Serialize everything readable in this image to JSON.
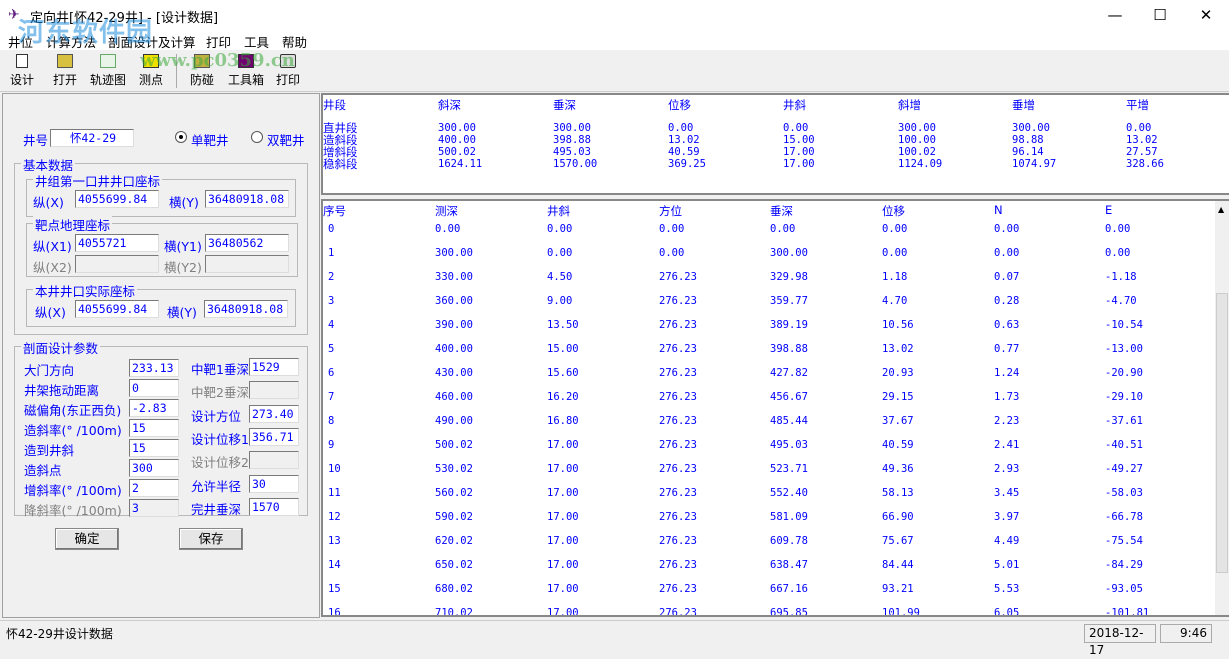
{
  "window": {
    "title": "定向井[怀42-29井] - [设计数据]",
    "minimize": "—",
    "maximize": "☐",
    "close": "✕"
  },
  "watermark": {
    "text": "河东软件园",
    "url": "www.pc0359.cn"
  },
  "menu": [
    "井位",
    "计算方法",
    "剖面设计及计算",
    "打印",
    "工具",
    "帮助"
  ],
  "toolbar": [
    {
      "label": "设计",
      "icon": "new-document-icon"
    },
    {
      "label": "打开",
      "icon": "open-folder-icon"
    },
    {
      "label": "轨迹图",
      "icon": "trajectory-chart-icon"
    },
    {
      "label": "测点",
      "icon": "survey-point-icon"
    },
    {
      "label": "防碰",
      "icon": "anti-collision-icon"
    },
    {
      "label": "工具箱",
      "icon": "toolbox-icon"
    },
    {
      "label": "打印",
      "icon": "printer-icon"
    }
  ],
  "form": {
    "well_no_label": "井号",
    "well_no": "怀42-29",
    "single_target": "单靶井",
    "double_target": "双靶井",
    "single_selected": true,
    "basic_group": "基本数据",
    "group_first": "井组第一口井井口座标",
    "x_label": "纵(X)",
    "y_label": "横(Y)",
    "first_x": "4055699.84",
    "first_y": "36480918.08",
    "group_target": "靶点地理座标",
    "x1_label": "纵(X1)",
    "y1_label": "横(Y1)",
    "x1": "4055721",
    "y1": "36480562",
    "x2_label": "纵(X2)",
    "y2_label": "横(Y2)",
    "x2": "",
    "y2": "",
    "group_actual": "本井井口实际座标",
    "actual_x": "4055699.84",
    "actual_y": "36480918.08",
    "profile_group": "剖面设计参数",
    "left_params": [
      {
        "label": "大门方向",
        "value": "233.13",
        "enabled": true
      },
      {
        "label": "井架拖动距离",
        "value": "0",
        "enabled": true
      },
      {
        "label": "磁偏角(东正西负)",
        "value": "-2.83",
        "enabled": true
      },
      {
        "label": "造斜率(° /100m)",
        "value": "15",
        "enabled": true
      },
      {
        "label": "造到井斜",
        "value": "15",
        "enabled": true
      },
      {
        "label": "造斜点",
        "value": "300",
        "enabled": true
      },
      {
        "label": "增斜率(° /100m)",
        "value": "2",
        "enabled": true
      },
      {
        "label": "降斜率(° /100m)",
        "value": "3",
        "enabled": false
      }
    ],
    "right_params": [
      {
        "label": "中靶1垂深",
        "value": "1529",
        "enabled": true
      },
      {
        "label": "中靶2垂深",
        "value": "",
        "enabled": false
      },
      {
        "label": "设计方位",
        "value": "273.40",
        "enabled": true
      },
      {
        "label": "设计位移1",
        "value": "356.71",
        "enabled": true
      },
      {
        "label": "设计位移2",
        "value": "",
        "enabled": false
      },
      {
        "label": "允许半径",
        "value": "30",
        "enabled": true
      },
      {
        "label": "完井垂深",
        "value": "1570",
        "enabled": true
      }
    ],
    "ok": "确定",
    "save": "保存"
  },
  "summary": {
    "headers": [
      "井段",
      "斜深",
      "垂深",
      "位移",
      "井斜",
      "斜增",
      "垂增",
      "平增"
    ],
    "rows": [
      [
        "直井段",
        "300.00",
        "300.00",
        "0.00",
        "0.00",
        "300.00",
        "300.00",
        "0.00"
      ],
      [
        "造斜段",
        "400.00",
        "398.88",
        "13.02",
        "15.00",
        "100.00",
        "98.88",
        "13.02"
      ],
      [
        "增斜段",
        "500.02",
        "495.03",
        "40.59",
        "17.00",
        "100.02",
        "96.14",
        "27.57"
      ],
      [
        "稳斜段",
        "1624.11",
        "1570.00",
        "369.25",
        "17.00",
        "1124.09",
        "1074.97",
        "328.66"
      ]
    ]
  },
  "detail": {
    "headers": [
      "序号",
      "测深",
      "井斜",
      "方位",
      "垂深",
      "位移",
      "N",
      "E"
    ],
    "rows": [
      [
        "0",
        "0.00",
        "0.00",
        "0.00",
        "0.00",
        "0.00",
        "0.00",
        "0.00"
      ],
      [
        "1",
        "300.00",
        "0.00",
        "0.00",
        "300.00",
        "0.00",
        "0.00",
        "0.00"
      ],
      [
        "2",
        "330.00",
        "4.50",
        "276.23",
        "329.98",
        "1.18",
        "0.07",
        "-1.18"
      ],
      [
        "3",
        "360.00",
        "9.00",
        "276.23",
        "359.77",
        "4.70",
        "0.28",
        "-4.70"
      ],
      [
        "4",
        "390.00",
        "13.50",
        "276.23",
        "389.19",
        "10.56",
        "0.63",
        "-10.54"
      ],
      [
        "5",
        "400.00",
        "15.00",
        "276.23",
        "398.88",
        "13.02",
        "0.77",
        "-13.00"
      ],
      [
        "6",
        "430.00",
        "15.60",
        "276.23",
        "427.82",
        "20.93",
        "1.24",
        "-20.90"
      ],
      [
        "7",
        "460.00",
        "16.20",
        "276.23",
        "456.67",
        "29.15",
        "1.73",
        "-29.10"
      ],
      [
        "8",
        "490.00",
        "16.80",
        "276.23",
        "485.44",
        "37.67",
        "2.23",
        "-37.61"
      ],
      [
        "9",
        "500.02",
        "17.00",
        "276.23",
        "495.03",
        "40.59",
        "2.41",
        "-40.51"
      ],
      [
        "10",
        "530.02",
        "17.00",
        "276.23",
        "523.71",
        "49.36",
        "2.93",
        "-49.27"
      ],
      [
        "11",
        "560.02",
        "17.00",
        "276.23",
        "552.40",
        "58.13",
        "3.45",
        "-58.03"
      ],
      [
        "12",
        "590.02",
        "17.00",
        "276.23",
        "581.09",
        "66.90",
        "3.97",
        "-66.78"
      ],
      [
        "13",
        "620.02",
        "17.00",
        "276.23",
        "609.78",
        "75.67",
        "4.49",
        "-75.54"
      ],
      [
        "14",
        "650.02",
        "17.00",
        "276.23",
        "638.47",
        "84.44",
        "5.01",
        "-84.29"
      ],
      [
        "15",
        "680.02",
        "17.00",
        "276.23",
        "667.16",
        "93.21",
        "5.53",
        "-93.05"
      ],
      [
        "16",
        "710.02",
        "17.00",
        "276.23",
        "695.85",
        "101.99",
        "6.05",
        "-101.81"
      ]
    ]
  },
  "status": {
    "text": "怀42-29井设计数据",
    "date": "2018-12-17",
    "time": "9:46"
  },
  "colors": {
    "text": "#0000ff",
    "disabled": "#808080"
  }
}
